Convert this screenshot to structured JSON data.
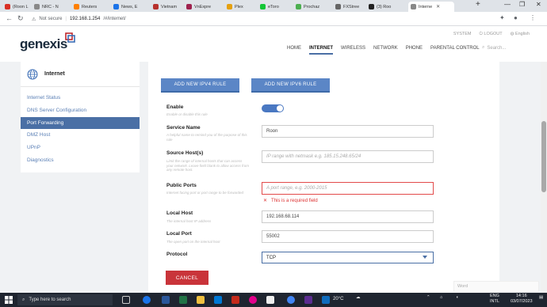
{
  "browser": {
    "tabs": [
      {
        "label": "(Roon L",
        "color": "#d93025"
      },
      {
        "label": "NRC - N",
        "color": "#888888"
      },
      {
        "label": "Reuters",
        "color": "#ff8000"
      },
      {
        "label": "News, E",
        "color": "#1a73e8"
      },
      {
        "label": "Vietnam",
        "color": "#b7312c"
      },
      {
        "label": "VnExpre",
        "color": "#9f224e"
      },
      {
        "label": "Plex",
        "color": "#e5a00d"
      },
      {
        "label": "eToro",
        "color": "#13c636"
      },
      {
        "label": "Prochaz",
        "color": "#4caf50"
      },
      {
        "label": "FXStree",
        "color": "#666666"
      },
      {
        "label": "(3) Roo",
        "color": "#222222"
      },
      {
        "label": "Interne",
        "color": "#888888"
      }
    ],
    "new_tab": "+",
    "minimize": "—",
    "maximize": "❐",
    "close": "✕",
    "url_security": "Not secure",
    "url_host": "192.168.1.254",
    "url_path": "/#/internet/"
  },
  "header": {
    "logo": "genexis",
    "top_links": {
      "system": "SYSTEM",
      "logout": "LOGOUT",
      "language": "English"
    },
    "nav": [
      {
        "label": "HOME",
        "active": false
      },
      {
        "label": "INTERNET",
        "active": true
      },
      {
        "label": "WIRELESS",
        "active": false
      },
      {
        "label": "NETWORK",
        "active": false
      },
      {
        "label": "PHONE",
        "active": false
      },
      {
        "label": "PARENTAL CONTROL",
        "active": false
      }
    ],
    "search_placeholder": "Search..."
  },
  "sidebar": {
    "title": "Internet",
    "items": [
      {
        "label": "Internet Status",
        "active": false
      },
      {
        "label": "DNS Server Configuration",
        "active": false
      },
      {
        "label": "Port Forwarding",
        "active": true
      },
      {
        "label": "DMZ Host",
        "active": false
      },
      {
        "label": "UPnP",
        "active": false
      },
      {
        "label": "Diagnostics",
        "active": false
      }
    ]
  },
  "form": {
    "cut_row": [
      "Roon",
      "2000-2015",
      "192.168.68.114",
      "55002",
      "TCP"
    ],
    "add_ipv4": "ADD NEW IPV4 RULE",
    "add_ipv6": "ADD NEW IPV6 RULE",
    "enable": {
      "label": "Enable",
      "help": "Enable or disable this rule",
      "value": true
    },
    "service_name": {
      "label": "Service Name",
      "help": "A helpful name to remind you of the purpose of this rule",
      "value": "Roon"
    },
    "source_hosts": {
      "label": "Source Host(s)",
      "help": "Limit the range of internal hosts that can access your network. Leave field blank to allow access from any remote host.",
      "placeholder": "IP range with netmask e.g. 185.15.248.65/24"
    },
    "public_ports": {
      "label": "Public Ports",
      "help": "Internet facing port or port range to be forwarded",
      "placeholder": "A port range, e.g. 2000-2015",
      "error": "This is a required field"
    },
    "local_host": {
      "label": "Local Host",
      "help": "The internal host IP address",
      "value": "192.168.68.114"
    },
    "local_port": {
      "label": "Local Port",
      "help": "The open port on the internal host",
      "value": "55002"
    },
    "protocol": {
      "label": "Protocol",
      "value": "TCP"
    },
    "cancel": "CANCEL"
  },
  "overlay": {
    "watermark": "Word"
  },
  "taskbar": {
    "search": "Type here to search",
    "weather": "20°C",
    "lang_top": "ENG",
    "lang_bottom": "INTL",
    "time": "14:16",
    "date": "03/07/2023"
  }
}
